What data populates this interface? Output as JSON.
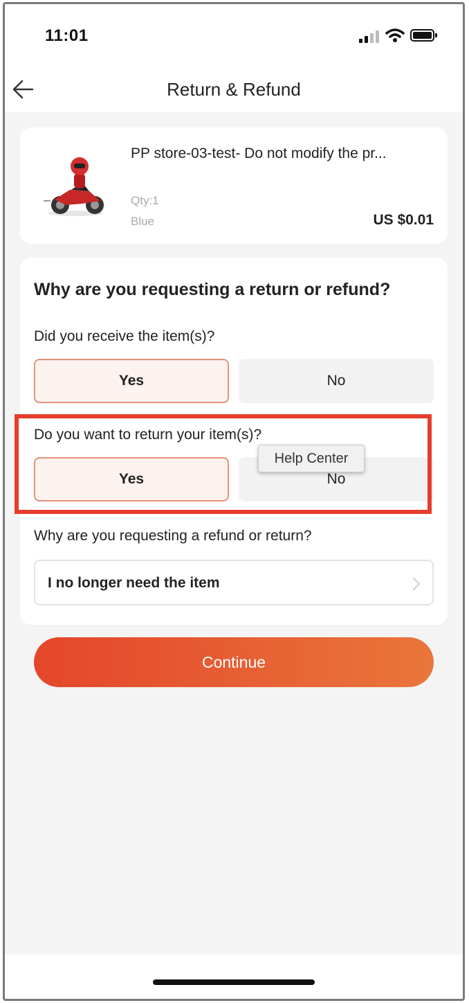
{
  "status_bar": {
    "time": "11:01"
  },
  "nav": {
    "title": "Return & Refund"
  },
  "product": {
    "title": "PP store-03-test- Do not modify the pr...",
    "qty": "Qty:1",
    "color": "Blue",
    "price": "US $0.01"
  },
  "questions": {
    "heading": "Why are you requesting a return or refund?",
    "received": {
      "label": "Did you receive the item(s)?",
      "yes": "Yes",
      "no": "No",
      "selected": "Yes"
    },
    "return_items": {
      "label": "Do you want to return your item(s)?",
      "yes": "Yes",
      "no": "No",
      "selected": "Yes"
    },
    "reason": {
      "label": "Why are you requesting a refund or return?",
      "value": "I no longer need the item"
    }
  },
  "tooltip": {
    "text": "Help Center"
  },
  "continue_label": "Continue",
  "colors": {
    "accent": "#e4462a",
    "highlight_box": "#e73c2b",
    "selected_border": "#e4917a"
  }
}
